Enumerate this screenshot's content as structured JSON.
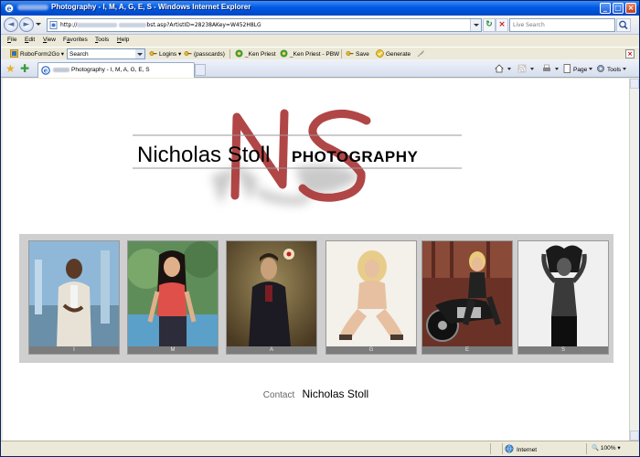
{
  "window": {
    "title": "Photography - I, M, A, G, E, S - Windows Internet Explorer",
    "minimize_glyph": "_",
    "maximize_glyph": "□",
    "close_glyph": "×"
  },
  "navbar": {
    "back_glyph": "◄",
    "forward_glyph": "►",
    "address_visible_start": "http://",
    "address_visible_end": "bst.asp?ArtistID=28238AKey=W452H8LG",
    "refresh_glyph": "↻",
    "stop_glyph": "×",
    "search_placeholder": "Live Search"
  },
  "menubar": {
    "items": [
      {
        "accel": "F",
        "rest": "ile"
      },
      {
        "accel": "E",
        "rest": "dit"
      },
      {
        "accel": "V",
        "rest": "iew"
      },
      {
        "pre": "F",
        "accel": "a",
        "rest": "vorites"
      },
      {
        "accel": "T",
        "rest": "ools"
      },
      {
        "accel": "H",
        "rest": "elp"
      }
    ]
  },
  "roboform": {
    "brand": "RoboForm2Go",
    "search_value": "Search",
    "logins": "Logins",
    "passcards": "(passcards)",
    "ken_priest": "_Ken Priest",
    "ken_priest_pbw": "_Ken Priest - PBW",
    "save": "Save",
    "generate": "Generate",
    "close_glyph": "×"
  },
  "tabs": {
    "active_tab": "Photography - I, M, A, G, E, S"
  },
  "command_bar": {
    "page": "Page",
    "tools": "Tools"
  },
  "logo": {
    "name": "Nicholas Stoll",
    "sub": "PHOTOGRAPHY",
    "monogram": "NS"
  },
  "gallery": {
    "captions": [
      "I",
      "M",
      "A",
      "G",
      "E",
      "S"
    ]
  },
  "contact": {
    "label": "Contact",
    "name": "Nicholas Stoll"
  },
  "status": {
    "zone": "Internet",
    "zoom": "100%"
  },
  "colors": {
    "monogram": "#a83232",
    "gallery_bg": "#cfcfcf",
    "caption_bg": "#7c7c7c",
    "titlebar": "#0058e6"
  }
}
